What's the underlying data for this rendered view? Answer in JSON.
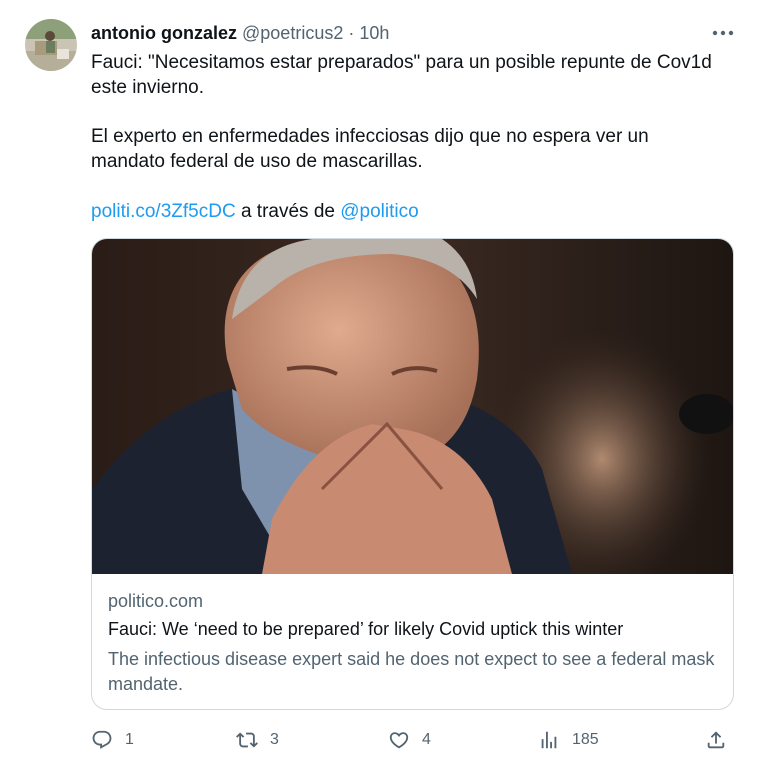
{
  "user": {
    "name": "antonio gonzalez",
    "handle": "@poetricus2",
    "separator": "·",
    "time": "10h"
  },
  "tweet": {
    "line1": "Fauci: \"Necesitamos estar preparados\" para un posible repunte de Cov1d",
    "line2": "este invierno.",
    "line3": "El experto en enfermedades infecciosas dijo que no espera ver un",
    "line4": "mandato federal de uso de mascarillas.",
    "link": "politi.co/3Zf5cDC",
    "via": " a través de ",
    "mention": "@politico"
  },
  "card": {
    "domain": "politico.com",
    "title": "Fauci: We ‘need to be prepared’ for likely Covid uptick this winter",
    "description": "The infectious disease expert said he does not expect to see a federal mask mandate."
  },
  "actions": {
    "replies": "1",
    "retweets": "3",
    "likes": "4",
    "views": "185"
  },
  "icons": {
    "more": "more-icon",
    "reply": "reply-icon",
    "retweet": "retweet-icon",
    "like": "heart-icon",
    "views": "views-icon",
    "share": "share-icon"
  },
  "colors": {
    "link": "#1d9bf0",
    "secondary_text": "#536471",
    "primary_text": "#0f1419",
    "border": "#cfd9de"
  }
}
